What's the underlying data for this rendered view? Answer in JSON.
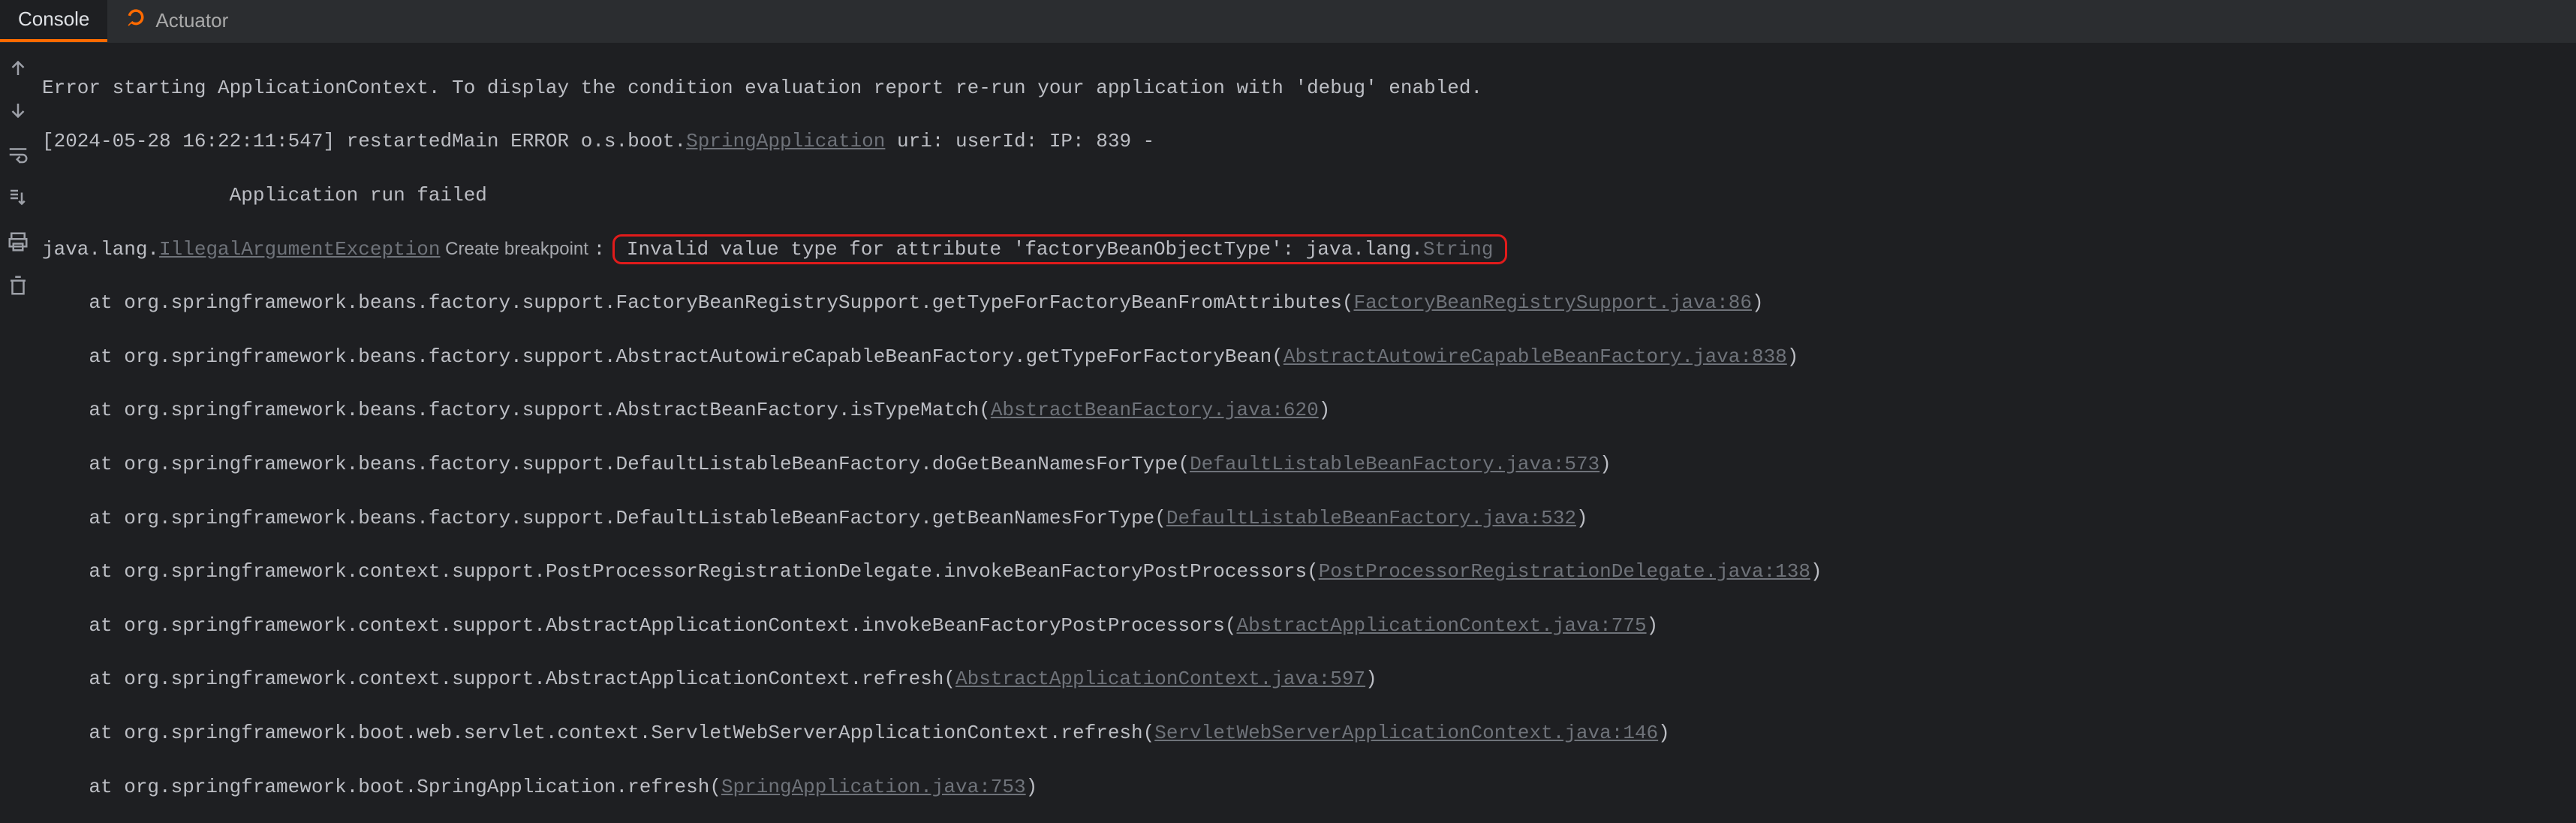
{
  "tabs": {
    "console": "Console",
    "actuator": "Actuator"
  },
  "l1": "Error starting ApplicationContext. To display the condition evaluation report re-run your application with 'debug' enabled.",
  "ts_open": "[2024-05-28 16:22:11:547] restartedMain ERROR o.s.boot.",
  "ts_link": "SpringApplication",
  "ts_rest": " uri: userId: IP: 839 -",
  "runfailed_pad": "                ",
  "runfailed": "Application run failed",
  "ex_prefix": "java.lang.",
  "ex_link": "IllegalArgumentException",
  "bp_label": " Create breakpoint ",
  "ex_msg_a": ": ",
  "ex_msg_box": "Invalid value type for attribute 'factoryBeanObjectType': java.lang.",
  "ex_msg_tail": "String",
  "st": [
    {
      "pre": "    at org.springframework.beans.factory.support.FactoryBeanRegistrySupport.getTypeForFactoryBeanFromAttributes(",
      "link": "FactoryBeanRegistrySupport.java:86",
      "post": ")"
    },
    {
      "pre": "    at org.springframework.beans.factory.support.AbstractAutowireCapableBeanFactory.getTypeForFactoryBean(",
      "link": "AbstractAutowireCapableBeanFactory.java:838",
      "post": ")"
    },
    {
      "pre": "    at org.springframework.beans.factory.support.AbstractBeanFactory.isTypeMatch(",
      "link": "AbstractBeanFactory.java:620",
      "post": ")"
    },
    {
      "pre": "    at org.springframework.beans.factory.support.DefaultListableBeanFactory.doGetBeanNamesForType(",
      "link": "DefaultListableBeanFactory.java:573",
      "post": ")"
    },
    {
      "pre": "    at org.springframework.beans.factory.support.DefaultListableBeanFactory.getBeanNamesForType(",
      "link": "DefaultListableBeanFactory.java:532",
      "post": ")"
    },
    {
      "pre": "    at org.springframework.context.support.PostProcessorRegistrationDelegate.invokeBeanFactoryPostProcessors(",
      "link": "PostProcessorRegistrationDelegate.java:138",
      "post": ")"
    },
    {
      "pre": "    at org.springframework.context.support.AbstractApplicationContext.invokeBeanFactoryPostProcessors(",
      "link": "AbstractApplicationContext.java:775",
      "post": ")"
    },
    {
      "pre": "    at org.springframework.context.support.AbstractApplicationContext.refresh(",
      "link": "AbstractApplicationContext.java:597",
      "post": ")"
    },
    {
      "pre": "    at org.springframework.boot.web.servlet.context.ServletWebServerApplicationContext.refresh(",
      "link": "ServletWebServerApplicationContext.java:146",
      "post": ")"
    },
    {
      "pre": "    at org.springframework.boot.SpringApplication.refresh(",
      "link": "SpringApplication.java:753",
      "post": ")"
    }
  ]
}
